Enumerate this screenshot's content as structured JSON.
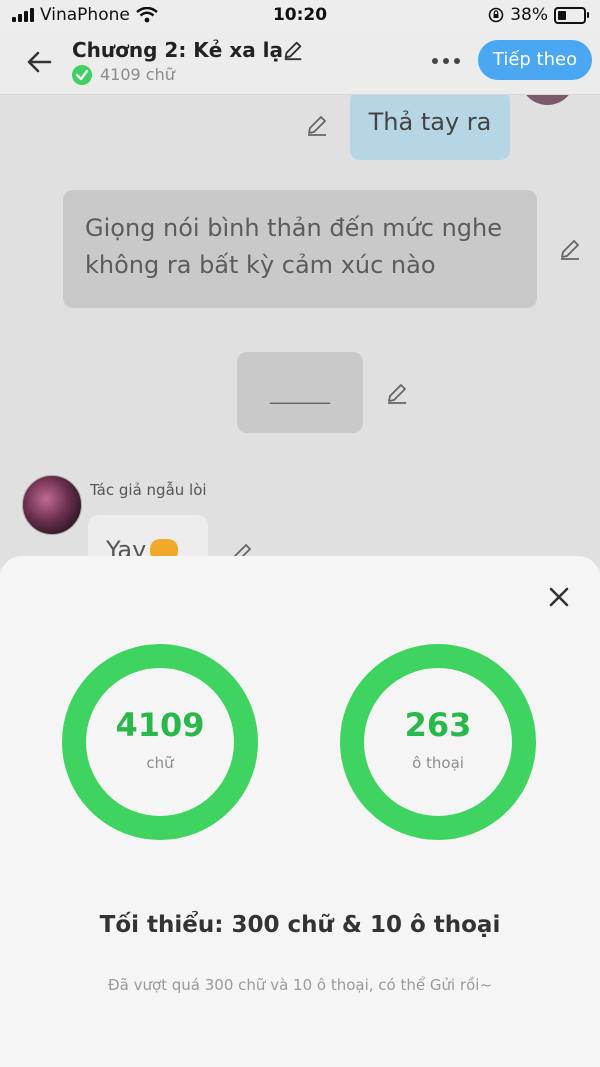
{
  "status_bar": {
    "carrier": "VinaPhone",
    "time": "10:20",
    "battery": "38%",
    "battery_level": 0.38
  },
  "header": {
    "title": "Chương 2: Kẻ xa lạ",
    "word_count": "4109 chữ",
    "next_button": "Tiếp theo"
  },
  "chat": {
    "messages": [
      {
        "text": "Thả tay ra"
      },
      {
        "text": "Giọng nói bình thản đến mức nghe không ra bất kỳ cảm xúc nào"
      },
      {
        "text": "______"
      },
      {
        "text": "Yay"
      }
    ],
    "author_name": "Tác giả ngẫu lòi"
  },
  "sheet": {
    "words_value": "4109",
    "words_label": "chữ",
    "dialogs_value": "263",
    "dialogs_label": "ô thoại",
    "minimum_text": "Tối thiểu: 300 chữ & 10 ô thoại",
    "note_text": "Đã vượt quá 300 chữ và 10 ô thoại, có thể Gửi rồi~"
  },
  "colors": {
    "accent_green": "#3fd45f",
    "button_blue": "#4aa7f2"
  },
  "icons": [
    "signal-icon",
    "wifi-icon",
    "lock-rotation-icon",
    "battery-icon",
    "back-arrow-icon",
    "pencil-icon",
    "check-icon",
    "more-icon",
    "close-icon"
  ]
}
